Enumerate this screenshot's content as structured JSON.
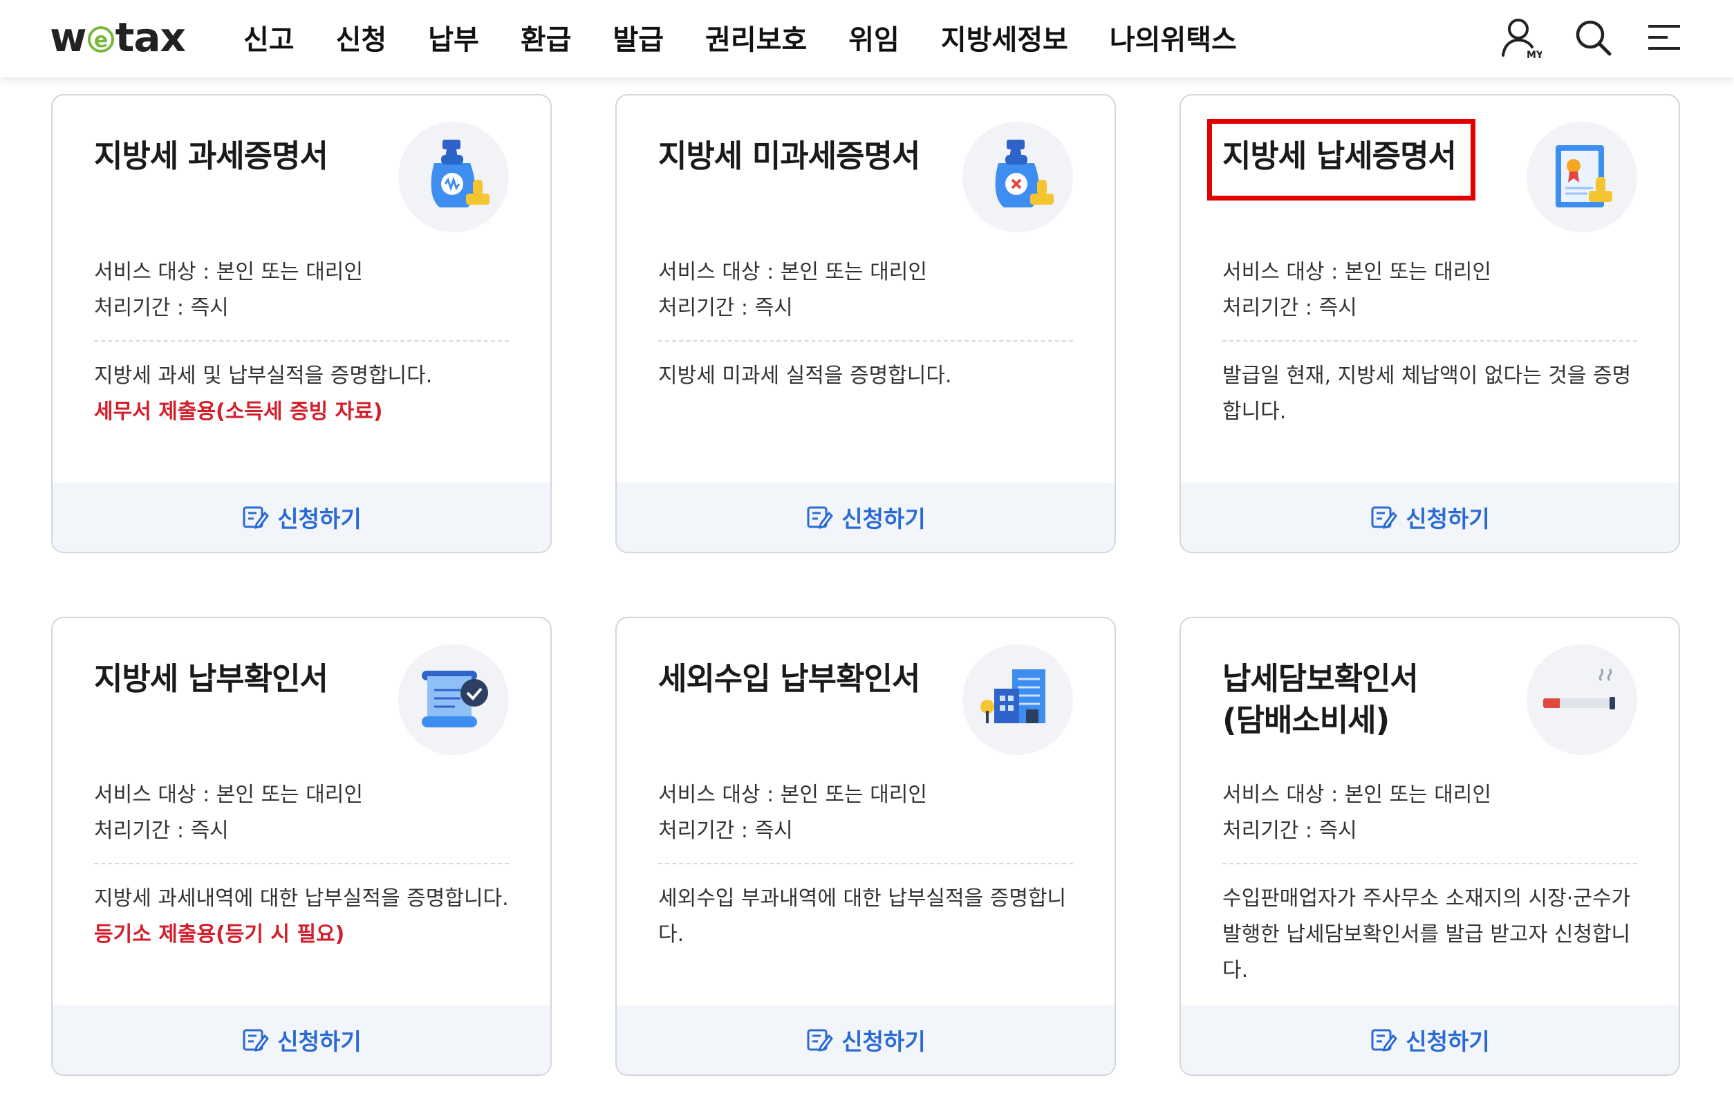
{
  "header": {
    "logo": {
      "w": "w",
      "e": "e",
      "tax": "tax"
    },
    "nav": [
      "신고",
      "신청",
      "납부",
      "환급",
      "발급",
      "권리보호",
      "위임",
      "지방세정보",
      "나의위택스"
    ],
    "my_badge": "MY"
  },
  "cards": [
    {
      "title_lines": [
        "지방세 과세증명서"
      ],
      "target": "서비스 대상 : 본인 또는 대리인",
      "period": "처리기간 : 즉시",
      "desc": "지방세 과세 및 납부실적을 증명합니다.",
      "note": "세무서 제출용(소득세 증빙 자료)",
      "apply": "신청하기",
      "icon": "money-bag-stamp-icon"
    },
    {
      "title_lines": [
        "지방세 미과세증명서"
      ],
      "target": "서비스 대상 : 본인 또는 대리인",
      "period": "처리기간 : 즉시",
      "desc": "지방세 미과세 실적을 증명합니다.",
      "note": "",
      "apply": "신청하기",
      "icon": "money-bag-x-stamp-icon"
    },
    {
      "title_lines": [
        "지방세 납세증명서"
      ],
      "target": "서비스 대상 : 본인 또는 대리인",
      "period": "처리기간 : 즉시",
      "desc": "발급일 현재, 지방세 체납액이 없다는 것을 증명합니다.",
      "note": "",
      "apply": "신청하기",
      "icon": "certificate-stamp-icon"
    },
    {
      "title_lines": [
        "지방세 납부확인서"
      ],
      "target": "서비스 대상 : 본인 또는 대리인",
      "period": "처리기간 : 즉시",
      "desc": "지방세 과세내역에 대한 납부실적을 증명합니다.",
      "note": "등기소 제출용(등기 시 필요)",
      "apply": "신청하기",
      "icon": "scroll-check-icon"
    },
    {
      "title_lines": [
        "세외수입 납부확인서"
      ],
      "target": "서비스 대상 : 본인 또는 대리인",
      "period": "처리기간 : 즉시",
      "desc": "세외수입 부과내역에 대한 납부실적을 증명합니다.",
      "note": "",
      "apply": "신청하기",
      "icon": "buildings-icon"
    },
    {
      "title_lines": [
        "납세담보확인서",
        "(담배소비세)"
      ],
      "target": "서비스 대상 : 본인 또는 대리인",
      "period": "처리기간 : 즉시",
      "desc": "수입판매업자가 주사무소 소재지의 시장·군수가 발행한 납세담보확인서를 발급 받고자 신청합니다.",
      "note": "",
      "apply": "신청하기",
      "icon": "cigarette-icon"
    }
  ],
  "colors": {
    "accent_blue": "#2a6ad6",
    "note_red": "#d21f2b",
    "highlight_red": "#e00000",
    "logo_green": "#7ab83c"
  }
}
